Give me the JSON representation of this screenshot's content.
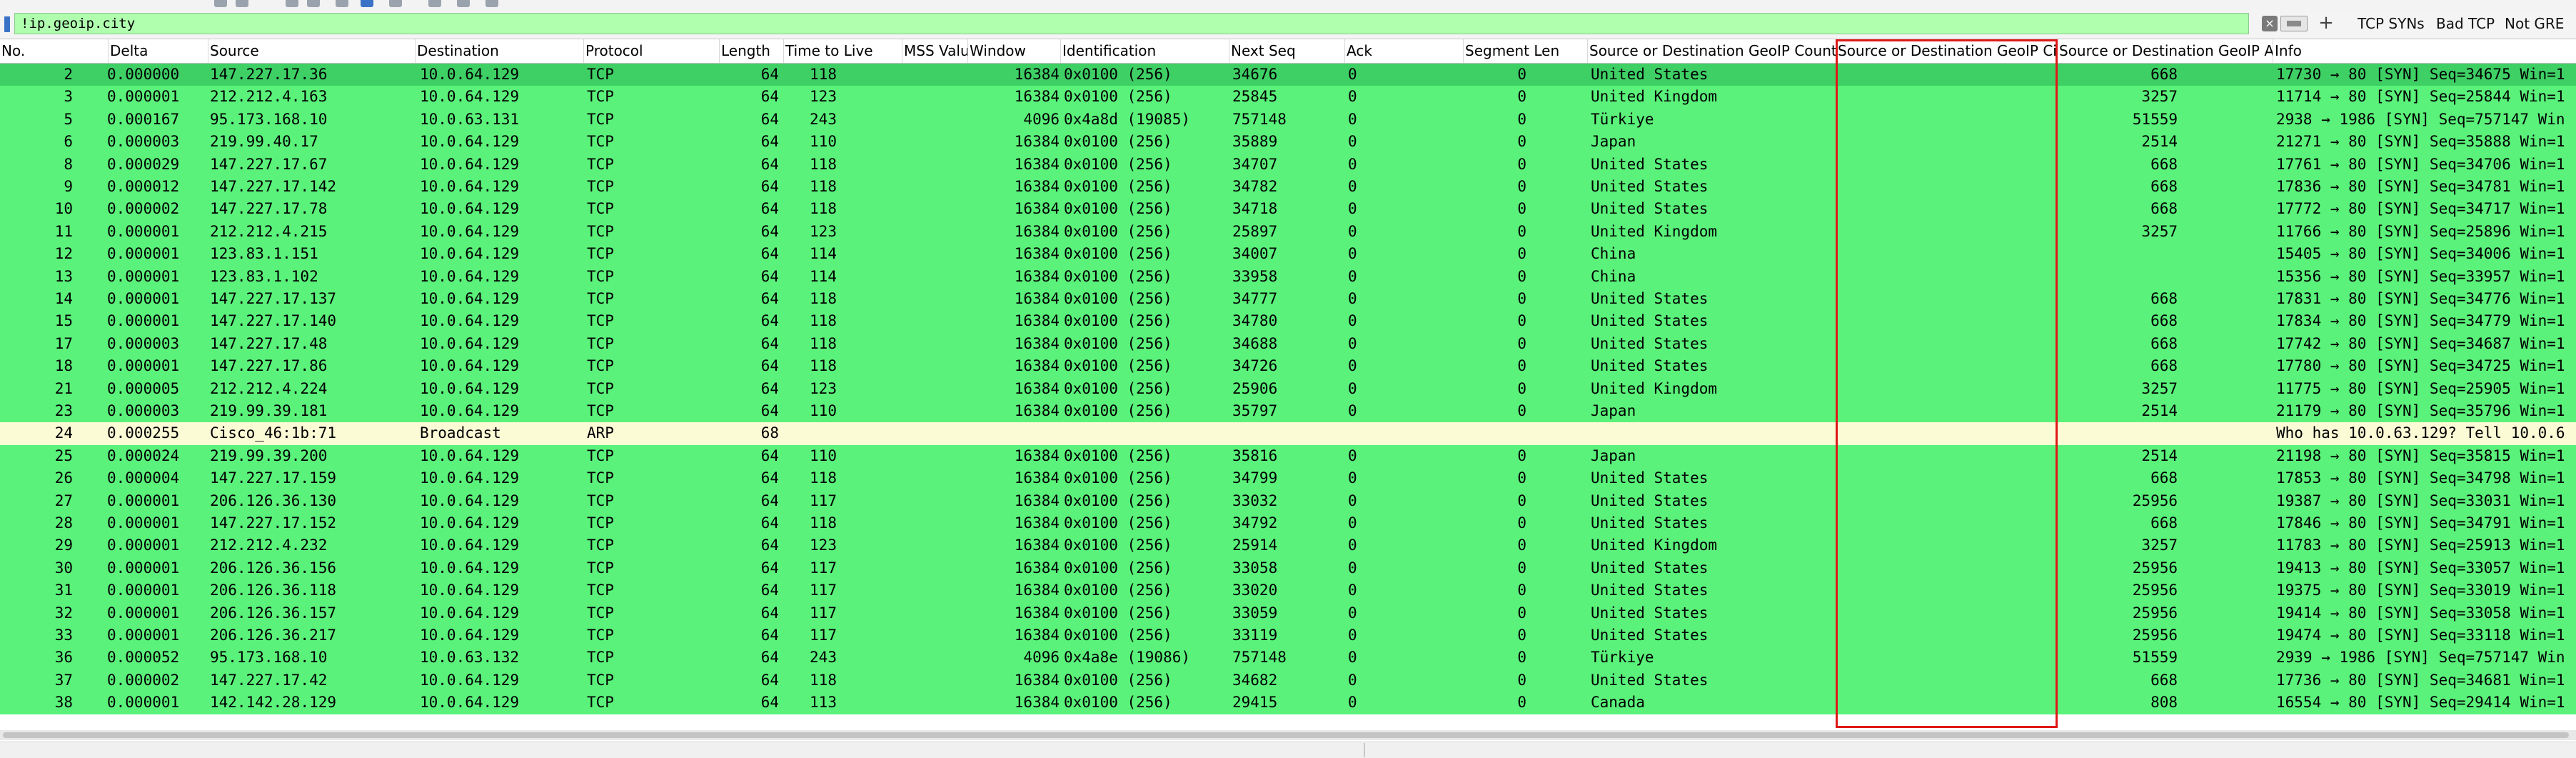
{
  "filter": {
    "value": "!ip.geoip.city",
    "buttons": [
      "TCP SYNs",
      "Bad TCP",
      "Not GRE"
    ],
    "add_glyph": "+",
    "clear_glyph": "×"
  },
  "colors": {
    "tcp_row": "#5af27a",
    "tcp_row_selected": "#3ed065",
    "arp_row": "#fbfbd6",
    "highlight_box": "#e01818",
    "filter_bg": "#afffaf"
  },
  "icons": [
    "bookmark-icon",
    "clear-icon",
    "apply-icon",
    "add-icon"
  ],
  "columns": [
    "No.",
    "Delta",
    "Source",
    "Destination",
    "Protocol",
    "Length",
    "Time to Live",
    "MSS Valu",
    "Window",
    "Identification",
    "Next Seq",
    "Ack",
    "Segment Len",
    "Source or Destination GeoIP Country",
    "Source or Destination GeoIP City",
    "Source or Destination GeoIP AS N",
    "Info"
  ],
  "rows": [
    {
      "no": "2",
      "delta": "0.000000",
      "src": "147.227.17.36",
      "dst": "10.0.64.129",
      "proto": "TCP",
      "len": "64",
      "ttl": "118",
      "mss": "",
      "win": "16384",
      "ident": "0x0100 (256)",
      "nseq": "34676",
      "ack": "0",
      "seglen": "0",
      "country": "United States",
      "city": "",
      "asn": "668",
      "info": "17730 → 80 [SYN] Seq=34675 Win=1",
      "type": "tcp",
      "selected": true
    },
    {
      "no": "3",
      "delta": "0.000001",
      "src": "212.212.4.163",
      "dst": "10.0.64.129",
      "proto": "TCP",
      "len": "64",
      "ttl": "123",
      "mss": "",
      "win": "16384",
      "ident": "0x0100 (256)",
      "nseq": "25845",
      "ack": "0",
      "seglen": "0",
      "country": "United Kingdom",
      "city": "",
      "asn": "3257",
      "info": "11714 → 80 [SYN] Seq=25844 Win=1",
      "type": "tcp"
    },
    {
      "no": "5",
      "delta": "0.000167",
      "src": "95.173.168.10",
      "dst": "10.0.63.131",
      "proto": "TCP",
      "len": "64",
      "ttl": "243",
      "mss": "",
      "win": "4096",
      "ident": "0x4a8d (19085)",
      "nseq": "757148",
      "ack": "0",
      "seglen": "0",
      "country": "Türkiye",
      "city": "",
      "asn": "51559",
      "info": "2938 → 1986 [SYN] Seq=757147 Win",
      "type": "tcp"
    },
    {
      "no": "6",
      "delta": "0.000003",
      "src": "219.99.40.17",
      "dst": "10.0.64.129",
      "proto": "TCP",
      "len": "64",
      "ttl": "110",
      "mss": "",
      "win": "16384",
      "ident": "0x0100 (256)",
      "nseq": "35889",
      "ack": "0",
      "seglen": "0",
      "country": "Japan",
      "city": "",
      "asn": "2514",
      "info": "21271 → 80 [SYN] Seq=35888 Win=1",
      "type": "tcp"
    },
    {
      "no": "8",
      "delta": "0.000029",
      "src": "147.227.17.67",
      "dst": "10.0.64.129",
      "proto": "TCP",
      "len": "64",
      "ttl": "118",
      "mss": "",
      "win": "16384",
      "ident": "0x0100 (256)",
      "nseq": "34707",
      "ack": "0",
      "seglen": "0",
      "country": "United States",
      "city": "",
      "asn": "668",
      "info": "17761 → 80 [SYN] Seq=34706 Win=1",
      "type": "tcp"
    },
    {
      "no": "9",
      "delta": "0.000012",
      "src": "147.227.17.142",
      "dst": "10.0.64.129",
      "proto": "TCP",
      "len": "64",
      "ttl": "118",
      "mss": "",
      "win": "16384",
      "ident": "0x0100 (256)",
      "nseq": "34782",
      "ack": "0",
      "seglen": "0",
      "country": "United States",
      "city": "",
      "asn": "668",
      "info": "17836 → 80 [SYN] Seq=34781 Win=1",
      "type": "tcp"
    },
    {
      "no": "10",
      "delta": "0.000002",
      "src": "147.227.17.78",
      "dst": "10.0.64.129",
      "proto": "TCP",
      "len": "64",
      "ttl": "118",
      "mss": "",
      "win": "16384",
      "ident": "0x0100 (256)",
      "nseq": "34718",
      "ack": "0",
      "seglen": "0",
      "country": "United States",
      "city": "",
      "asn": "668",
      "info": "17772 → 80 [SYN] Seq=34717 Win=1",
      "type": "tcp"
    },
    {
      "no": "11",
      "delta": "0.000001",
      "src": "212.212.4.215",
      "dst": "10.0.64.129",
      "proto": "TCP",
      "len": "64",
      "ttl": "123",
      "mss": "",
      "win": "16384",
      "ident": "0x0100 (256)",
      "nseq": "25897",
      "ack": "0",
      "seglen": "0",
      "country": "United Kingdom",
      "city": "",
      "asn": "3257",
      "info": "11766 → 80 [SYN] Seq=25896 Win=1",
      "type": "tcp"
    },
    {
      "no": "12",
      "delta": "0.000001",
      "src": "123.83.1.151",
      "dst": "10.0.64.129",
      "proto": "TCP",
      "len": "64",
      "ttl": "114",
      "mss": "",
      "win": "16384",
      "ident": "0x0100 (256)",
      "nseq": "34007",
      "ack": "0",
      "seglen": "0",
      "country": "China",
      "city": "",
      "asn": "",
      "info": "15405 → 80 [SYN] Seq=34006 Win=1",
      "type": "tcp"
    },
    {
      "no": "13",
      "delta": "0.000001",
      "src": "123.83.1.102",
      "dst": "10.0.64.129",
      "proto": "TCP",
      "len": "64",
      "ttl": "114",
      "mss": "",
      "win": "16384",
      "ident": "0x0100 (256)",
      "nseq": "33958",
      "ack": "0",
      "seglen": "0",
      "country": "China",
      "city": "",
      "asn": "",
      "info": "15356 → 80 [SYN] Seq=33957 Win=1",
      "type": "tcp"
    },
    {
      "no": "14",
      "delta": "0.000001",
      "src": "147.227.17.137",
      "dst": "10.0.64.129",
      "proto": "TCP",
      "len": "64",
      "ttl": "118",
      "mss": "",
      "win": "16384",
      "ident": "0x0100 (256)",
      "nseq": "34777",
      "ack": "0",
      "seglen": "0",
      "country": "United States",
      "city": "",
      "asn": "668",
      "info": "17831 → 80 [SYN] Seq=34776 Win=1",
      "type": "tcp"
    },
    {
      "no": "15",
      "delta": "0.000001",
      "src": "147.227.17.140",
      "dst": "10.0.64.129",
      "proto": "TCP",
      "len": "64",
      "ttl": "118",
      "mss": "",
      "win": "16384",
      "ident": "0x0100 (256)",
      "nseq": "34780",
      "ack": "0",
      "seglen": "0",
      "country": "United States",
      "city": "",
      "asn": "668",
      "info": "17834 → 80 [SYN] Seq=34779 Win=1",
      "type": "tcp"
    },
    {
      "no": "17",
      "delta": "0.000003",
      "src": "147.227.17.48",
      "dst": "10.0.64.129",
      "proto": "TCP",
      "len": "64",
      "ttl": "118",
      "mss": "",
      "win": "16384",
      "ident": "0x0100 (256)",
      "nseq": "34688",
      "ack": "0",
      "seglen": "0",
      "country": "United States",
      "city": "",
      "asn": "668",
      "info": "17742 → 80 [SYN] Seq=34687 Win=1",
      "type": "tcp"
    },
    {
      "no": "18",
      "delta": "0.000001",
      "src": "147.227.17.86",
      "dst": "10.0.64.129",
      "proto": "TCP",
      "len": "64",
      "ttl": "118",
      "mss": "",
      "win": "16384",
      "ident": "0x0100 (256)",
      "nseq": "34726",
      "ack": "0",
      "seglen": "0",
      "country": "United States",
      "city": "",
      "asn": "668",
      "info": "17780 → 80 [SYN] Seq=34725 Win=1",
      "type": "tcp"
    },
    {
      "no": "21",
      "delta": "0.000005",
      "src": "212.212.4.224",
      "dst": "10.0.64.129",
      "proto": "TCP",
      "len": "64",
      "ttl": "123",
      "mss": "",
      "win": "16384",
      "ident": "0x0100 (256)",
      "nseq": "25906",
      "ack": "0",
      "seglen": "0",
      "country": "United Kingdom",
      "city": "",
      "asn": "3257",
      "info": "11775 → 80 [SYN] Seq=25905 Win=1",
      "type": "tcp"
    },
    {
      "no": "23",
      "delta": "0.000003",
      "src": "219.99.39.181",
      "dst": "10.0.64.129",
      "proto": "TCP",
      "len": "64",
      "ttl": "110",
      "mss": "",
      "win": "16384",
      "ident": "0x0100 (256)",
      "nseq": "35797",
      "ack": "0",
      "seglen": "0",
      "country": "Japan",
      "city": "",
      "asn": "2514",
      "info": "21179 → 80 [SYN] Seq=35796 Win=1",
      "type": "tcp"
    },
    {
      "no": "24",
      "delta": "0.000255",
      "src": "Cisco_46:1b:71",
      "dst": "Broadcast",
      "proto": "ARP",
      "len": "68",
      "ttl": "",
      "mss": "",
      "win": "",
      "ident": "",
      "nseq": "",
      "ack": "",
      "seglen": "",
      "country": "",
      "city": "",
      "asn": "",
      "info": "Who has 10.0.63.129? Tell 10.0.6",
      "type": "arp"
    },
    {
      "no": "25",
      "delta": "0.000024",
      "src": "219.99.39.200",
      "dst": "10.0.64.129",
      "proto": "TCP",
      "len": "64",
      "ttl": "110",
      "mss": "",
      "win": "16384",
      "ident": "0x0100 (256)",
      "nseq": "35816",
      "ack": "0",
      "seglen": "0",
      "country": "Japan",
      "city": "",
      "asn": "2514",
      "info": "21198 → 80 [SYN] Seq=35815 Win=1",
      "type": "tcp"
    },
    {
      "no": "26",
      "delta": "0.000004",
      "src": "147.227.17.159",
      "dst": "10.0.64.129",
      "proto": "TCP",
      "len": "64",
      "ttl": "118",
      "mss": "",
      "win": "16384",
      "ident": "0x0100 (256)",
      "nseq": "34799",
      "ack": "0",
      "seglen": "0",
      "country": "United States",
      "city": "",
      "asn": "668",
      "info": "17853 → 80 [SYN] Seq=34798 Win=1",
      "type": "tcp"
    },
    {
      "no": "27",
      "delta": "0.000001",
      "src": "206.126.36.130",
      "dst": "10.0.64.129",
      "proto": "TCP",
      "len": "64",
      "ttl": "117",
      "mss": "",
      "win": "16384",
      "ident": "0x0100 (256)",
      "nseq": "33032",
      "ack": "0",
      "seglen": "0",
      "country": "United States",
      "city": "",
      "asn": "25956",
      "info": "19387 → 80 [SYN] Seq=33031 Win=1",
      "type": "tcp"
    },
    {
      "no": "28",
      "delta": "0.000001",
      "src": "147.227.17.152",
      "dst": "10.0.64.129",
      "proto": "TCP",
      "len": "64",
      "ttl": "118",
      "mss": "",
      "win": "16384",
      "ident": "0x0100 (256)",
      "nseq": "34792",
      "ack": "0",
      "seglen": "0",
      "country": "United States",
      "city": "",
      "asn": "668",
      "info": "17846 → 80 [SYN] Seq=34791 Win=1",
      "type": "tcp"
    },
    {
      "no": "29",
      "delta": "0.000001",
      "src": "212.212.4.232",
      "dst": "10.0.64.129",
      "proto": "TCP",
      "len": "64",
      "ttl": "123",
      "mss": "",
      "win": "16384",
      "ident": "0x0100 (256)",
      "nseq": "25914",
      "ack": "0",
      "seglen": "0",
      "country": "United Kingdom",
      "city": "",
      "asn": "3257",
      "info": "11783 → 80 [SYN] Seq=25913 Win=1",
      "type": "tcp"
    },
    {
      "no": "30",
      "delta": "0.000001",
      "src": "206.126.36.156",
      "dst": "10.0.64.129",
      "proto": "TCP",
      "len": "64",
      "ttl": "117",
      "mss": "",
      "win": "16384",
      "ident": "0x0100 (256)",
      "nseq": "33058",
      "ack": "0",
      "seglen": "0",
      "country": "United States",
      "city": "",
      "asn": "25956",
      "info": "19413 → 80 [SYN] Seq=33057 Win=1",
      "type": "tcp"
    },
    {
      "no": "31",
      "delta": "0.000001",
      "src": "206.126.36.118",
      "dst": "10.0.64.129",
      "proto": "TCP",
      "len": "64",
      "ttl": "117",
      "mss": "",
      "win": "16384",
      "ident": "0x0100 (256)",
      "nseq": "33020",
      "ack": "0",
      "seglen": "0",
      "country": "United States",
      "city": "",
      "asn": "25956",
      "info": "19375 → 80 [SYN] Seq=33019 Win=1",
      "type": "tcp"
    },
    {
      "no": "32",
      "delta": "0.000001",
      "src": "206.126.36.157",
      "dst": "10.0.64.129",
      "proto": "TCP",
      "len": "64",
      "ttl": "117",
      "mss": "",
      "win": "16384",
      "ident": "0x0100 (256)",
      "nseq": "33059",
      "ack": "0",
      "seglen": "0",
      "country": "United States",
      "city": "",
      "asn": "25956",
      "info": "19414 → 80 [SYN] Seq=33058 Win=1",
      "type": "tcp"
    },
    {
      "no": "33",
      "delta": "0.000001",
      "src": "206.126.36.217",
      "dst": "10.0.64.129",
      "proto": "TCP",
      "len": "64",
      "ttl": "117",
      "mss": "",
      "win": "16384",
      "ident": "0x0100 (256)",
      "nseq": "33119",
      "ack": "0",
      "seglen": "0",
      "country": "United States",
      "city": "",
      "asn": "25956",
      "info": "19474 → 80 [SYN] Seq=33118 Win=1",
      "type": "tcp"
    },
    {
      "no": "36",
      "delta": "0.000052",
      "src": "95.173.168.10",
      "dst": "10.0.63.132",
      "proto": "TCP",
      "len": "64",
      "ttl": "243",
      "mss": "",
      "win": "4096",
      "ident": "0x4a8e (19086)",
      "nseq": "757148",
      "ack": "0",
      "seglen": "0",
      "country": "Türkiye",
      "city": "",
      "asn": "51559",
      "info": "2939 → 1986 [SYN] Seq=757147 Win",
      "type": "tcp"
    },
    {
      "no": "37",
      "delta": "0.000002",
      "src": "147.227.17.42",
      "dst": "10.0.64.129",
      "proto": "TCP",
      "len": "64",
      "ttl": "118",
      "mss": "",
      "win": "16384",
      "ident": "0x0100 (256)",
      "nseq": "34682",
      "ack": "0",
      "seglen": "0",
      "country": "United States",
      "city": "",
      "asn": "668",
      "info": "17736 → 80 [SYN] Seq=34681 Win=1",
      "type": "tcp"
    },
    {
      "no": "38",
      "delta": "0.000001",
      "src": "142.142.28.129",
      "dst": "10.0.64.129",
      "proto": "TCP",
      "len": "64",
      "ttl": "113",
      "mss": "",
      "win": "16384",
      "ident": "0x0100 (256)",
      "nseq": "29415",
      "ack": "0",
      "seglen": "0",
      "country": "Canada",
      "city": "",
      "asn": "808",
      "info": "16554 → 80 [SYN] Seq=29414 Win=1",
      "type": "tcp"
    }
  ]
}
